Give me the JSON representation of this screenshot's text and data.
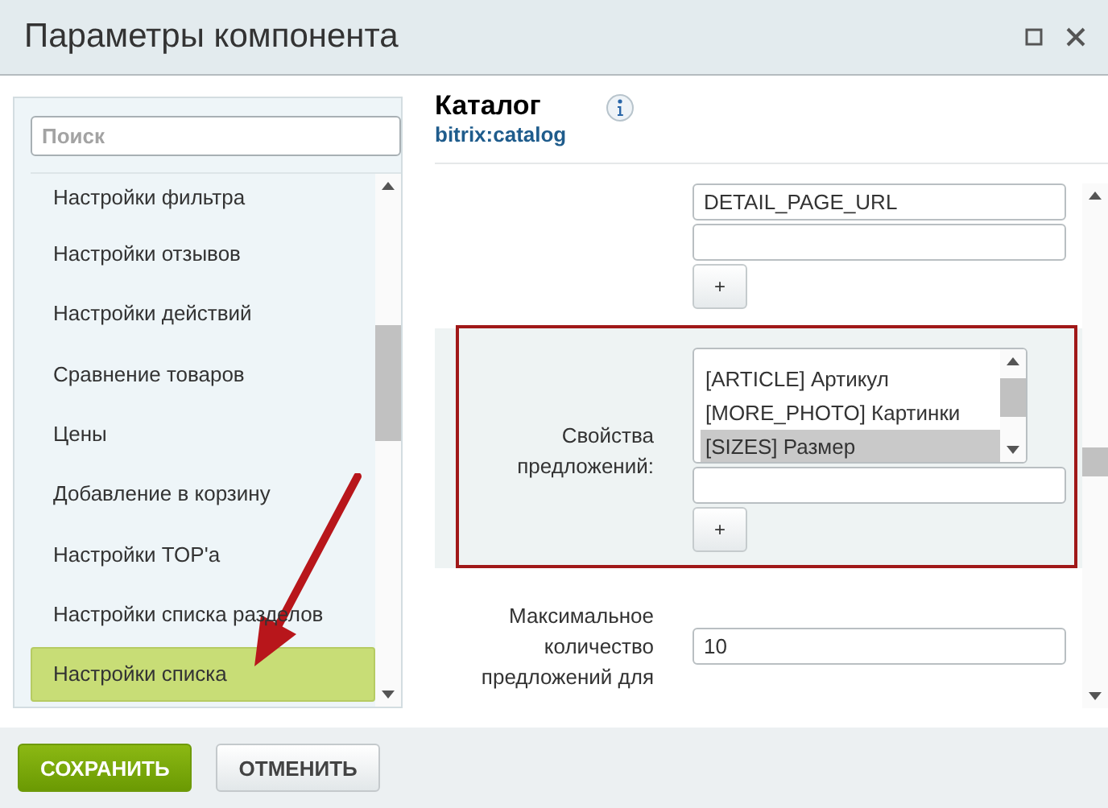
{
  "window": {
    "title": "Параметры компонента"
  },
  "sidebar": {
    "search": {
      "placeholder": "Поиск"
    },
    "items": [
      {
        "label": "Настройки фильтра",
        "selected": false
      },
      {
        "label": "Настройки отзывов",
        "selected": false
      },
      {
        "label": "Настройки действий",
        "selected": false
      },
      {
        "label": "Сравнение товаров",
        "selected": false
      },
      {
        "label": "Цены",
        "selected": false
      },
      {
        "label": "Добавление в корзину",
        "selected": false
      },
      {
        "label": "Настройки TOP'а",
        "selected": false
      },
      {
        "label": "Настройки списка разделов",
        "selected": false
      },
      {
        "label": "Настройки списка",
        "selected": true
      }
    ]
  },
  "component": {
    "title": "Каталог",
    "code": "bitrix:catalog"
  },
  "fields": [
    {
      "kind": "multi_text",
      "highlighted": false,
      "inputs": [
        {
          "kind": "filled",
          "value": "DETAIL_PAGE_URL"
        },
        {
          "kind": "blank"
        }
      ],
      "add_button": "+"
    },
    {
      "kind": "multi_select",
      "label": "Свойства предложений:",
      "highlighted": true,
      "options": [
        {
          "label": "[ARTICLE] Артикул",
          "selected": false
        },
        {
          "label": "[MORE_PHOTO] Картинки",
          "selected": false
        },
        {
          "label": "[SIZES] Размер",
          "selected": true
        }
      ],
      "inputs": [
        {
          "kind": "blank"
        }
      ],
      "add_button": "+"
    },
    {
      "kind": "text",
      "label": "Максимальное количество предложений для",
      "highlighted": false,
      "inputs": [
        {
          "kind": "filled",
          "value": "10"
        }
      ]
    }
  ],
  "buttons": [
    {
      "label": "СОХРАНИТЬ",
      "kind": "primary"
    },
    {
      "label": "ОТМЕНИТЬ",
      "kind": "secondary"
    }
  ]
}
